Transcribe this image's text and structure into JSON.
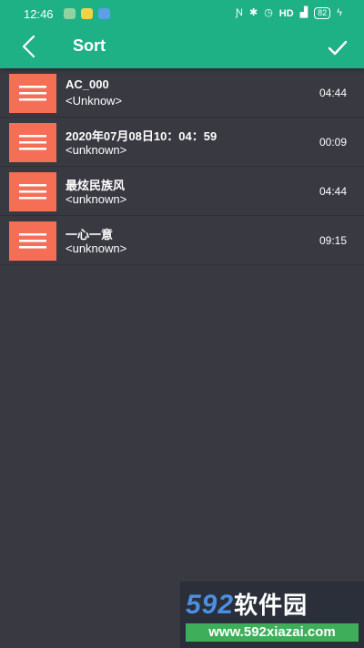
{
  "status_bar": {
    "time": "12:46",
    "network_label": "HD",
    "battery": "82"
  },
  "app_bar": {
    "title": "Sort"
  },
  "songs": [
    {
      "title": "AC_000",
      "artist": "<Unknow>",
      "duration": "04:44"
    },
    {
      "title": "2020年07月08日10：04：59",
      "artist": "<unknown>",
      "duration": "00:09"
    },
    {
      "title": "最炫民族风",
      "artist": "<unknown>",
      "duration": "04:44"
    },
    {
      "title": "一心一意",
      "artist": "<unknown>",
      "duration": "09:15"
    }
  ],
  "watermark": {
    "logo_number": "592",
    "logo_text": "软件园",
    "url": "www.592xiazai.com"
  },
  "colors": {
    "accent": "#1fb186",
    "handle": "#f56f57",
    "background": "#393942"
  }
}
